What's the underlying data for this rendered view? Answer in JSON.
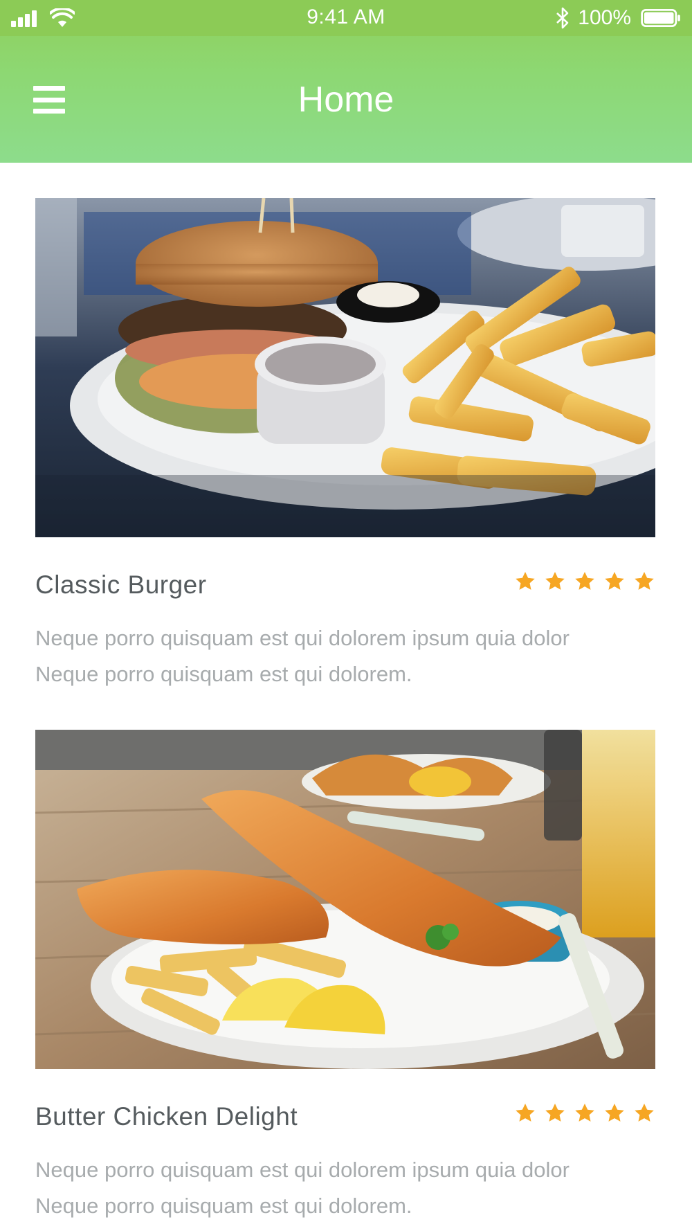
{
  "status_bar": {
    "time": "9:41 AM",
    "battery_text": "100%",
    "icons": [
      "signal-icon",
      "wifi-icon",
      "bluetooth-icon",
      "battery-icon"
    ]
  },
  "header": {
    "title": "Home",
    "menu_icon": "hamburger-menu-icon",
    "gradient_top": "#8fcf5b",
    "gradient_bottom": "#8ddc8c"
  },
  "cards": [
    {
      "title": "Classic Burger",
      "rating": 5,
      "description": "Neque porro quisquam est qui dolorem ipsum quia dolor Neque porro quisquam est qui dolorem.",
      "photo": "burger-and-fries-photo"
    },
    {
      "title": "Butter Chicken Delight",
      "rating": 5,
      "description": "Neque porro quisquam est qui dolorem ipsum quia dolor Neque porro quisquam est qui dolorem.",
      "photo": "fried-fish-and-chips-photo"
    }
  ],
  "colors": {
    "star": "#f6a623",
    "title_text": "#555b5e",
    "description_text": "#a7abad"
  }
}
